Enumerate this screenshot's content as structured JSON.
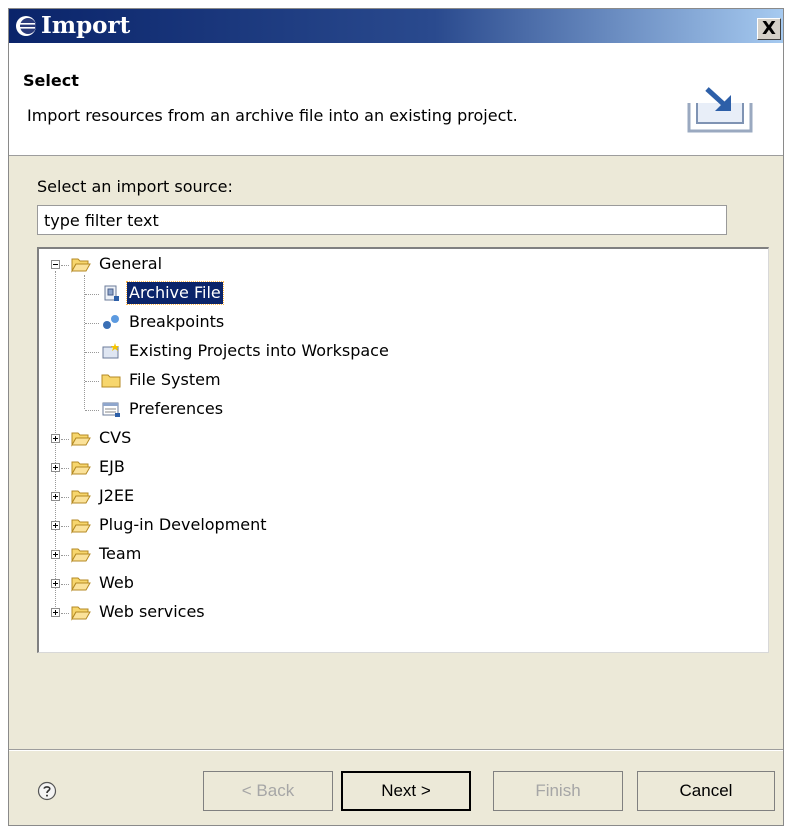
{
  "window": {
    "title": "Import",
    "close_label": "X"
  },
  "header": {
    "title": "Select",
    "description": "Import resources from an archive file into an existing project."
  },
  "filter": {
    "label": "Select an import source:",
    "value": "type filter text"
  },
  "tree": {
    "general": {
      "label": "General",
      "children": [
        "Archive File",
        "Breakpoints",
        "Existing Projects into Workspace",
        "File System",
        "Preferences"
      ]
    },
    "collapsed": [
      "CVS",
      "EJB",
      "J2EE",
      "Plug-in Development",
      "Team",
      "Web",
      "Web services"
    ]
  },
  "buttons": {
    "back": "< Back",
    "next": "Next >",
    "finish": "Finish",
    "cancel": "Cancel"
  },
  "icons": {
    "titlebar": "eclipse-icon",
    "header": "import-wizard-icon",
    "help": "help-icon"
  },
  "colors": {
    "selection": "#0a246a",
    "title_gradient_start": "#0a246a",
    "title_gradient_end": "#a6caf0",
    "folder": "#f7d66d"
  }
}
